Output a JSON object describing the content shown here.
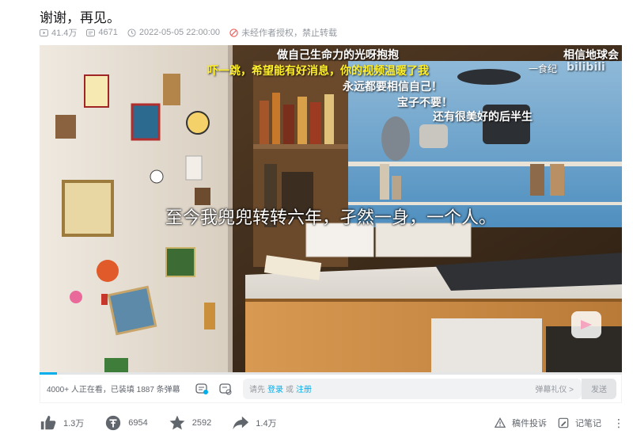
{
  "video": {
    "title": "谢谢，再见。",
    "views": "41.4万",
    "danmaku_count": "4671",
    "datetime": "2022-05-05 22:00:00",
    "copyright": "未经作者授权，禁止转载"
  },
  "player": {
    "subtitle": "至今我兜兜转转六年，孑然一身，一个人。",
    "overlay_danmaku": [
      "做自己生命力的光呀抱抱",
      "吓一跳，希望能有好消息，你的视频温暖了我",
      "永远都要相信自己！",
      "宝子不要！",
      "还有很美好的后半生",
      "相信地球会",
      "一食纪",
      "bilibili"
    ],
    "progress_fraction": 0.03
  },
  "bottombar": {
    "viewers_text": "4000+ 人正在看，已装填 1887 条弹幕",
    "input_prefix": "请先",
    "login": "登录",
    "or": "或",
    "register": "注册",
    "etiquette": "弹幕礼仪 >",
    "send": "发送"
  },
  "actions": {
    "like": "1.3万",
    "coin": "6954",
    "favorite": "2592",
    "share": "1.4万",
    "report": "稿件投诉",
    "notes": "记笔记"
  },
  "colors": {
    "accent": "#00aeec",
    "text_secondary": "#9499a0",
    "danmaku_yellow": "#fff02a"
  }
}
